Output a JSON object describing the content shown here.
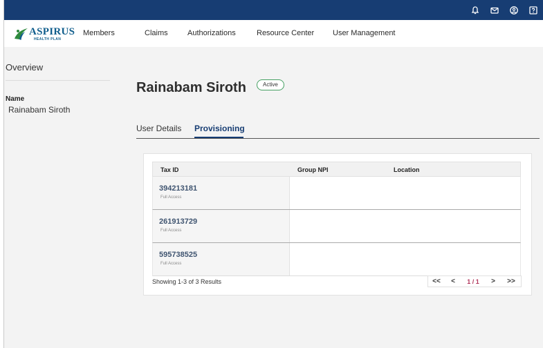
{
  "topbar": {
    "icons": [
      "bell-icon",
      "mail-icon",
      "user-circle-icon",
      "help-icon"
    ]
  },
  "brand": {
    "name": "ASPIRUS",
    "sub": "HEALTH PLAN"
  },
  "nav": {
    "items": [
      "Members",
      "Claims",
      "Authorizations",
      "Resource Center",
      "User Management"
    ]
  },
  "sidebar": {
    "overview": "Overview",
    "name_label": "Name",
    "name_value": "Rainabam Siroth"
  },
  "user": {
    "name": "Rainabam Siroth",
    "status": "Active"
  },
  "tabs": [
    "User Details",
    "Provisioning"
  ],
  "active_tab": "Provisioning",
  "table": {
    "columns": [
      "Tax ID",
      "Group NPI",
      "Location"
    ],
    "rows": [
      {
        "tax_id": "394213181",
        "access": "Full Access",
        "group_npi": "",
        "location": ""
      },
      {
        "tax_id": "261913729",
        "access": "Full Access",
        "group_npi": "",
        "location": ""
      },
      {
        "tax_id": "595738525",
        "access": "Full Access",
        "group_npi": "",
        "location": ""
      }
    ]
  },
  "pagination": {
    "summary": "Showing 1-3 of 3 Results",
    "first": "<<",
    "prev": "<",
    "page": "1 / 1",
    "next": ">",
    "last": ">>"
  },
  "colors": {
    "topbar": "#173d73",
    "accent": "#173d73",
    "badge_border": "#46a063",
    "page_number": "#b0345a"
  }
}
